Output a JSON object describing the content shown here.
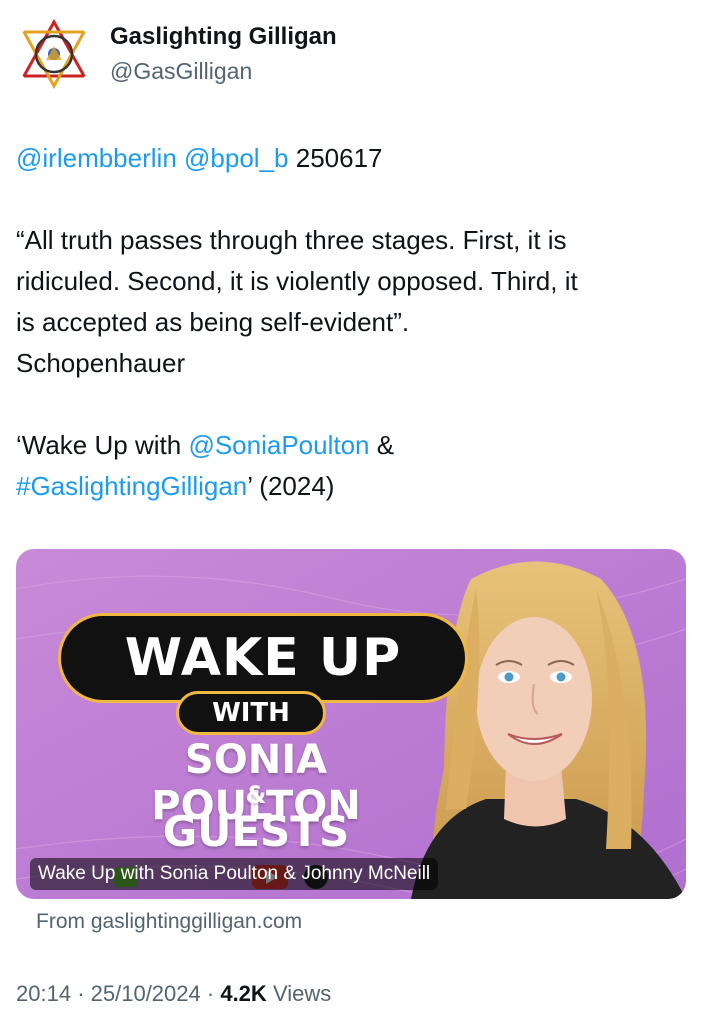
{
  "author": {
    "display_name": "Gaslighting Gilligan",
    "handle": "@GasGilligan"
  },
  "tweet": {
    "line1": {
      "mention1": "@irlembberlin",
      "mention2": "@bpol_b",
      "text": "250617"
    },
    "quote_line1": "“All truth passes through three stages. First, it is",
    "quote_line2": "ridiculed. Second, it is violently opposed. Third, it",
    "quote_line3": "is accepted as being self-evident”.",
    "quote_author": "Schopenhauer",
    "show_line1_prefix": "‘Wake Up with",
    "show_mention": "@SoniaPoulton",
    "show_line1_suffix": "&",
    "show_hashtag": "#GaslightingGilligan",
    "show_line2_suffix": "’ (2024)"
  },
  "card": {
    "title_big": "WAKE UP",
    "title_with": "WITH",
    "host_name": "SONIA POULTON",
    "ampersand": "&",
    "guests": "GUESTS",
    "caption": "Wake Up with Sonia Poulton & Johnny McNeill",
    "source": "From gaslightinggilligan.com"
  },
  "meta": {
    "time": "20:14",
    "separator": "·",
    "date": "25/10/2024",
    "views_count": "4.2K",
    "views_label": "Views"
  },
  "colors": {
    "link": "#1d9bf0",
    "secondary_text": "#536471",
    "card_bg": "#c98ad8"
  }
}
